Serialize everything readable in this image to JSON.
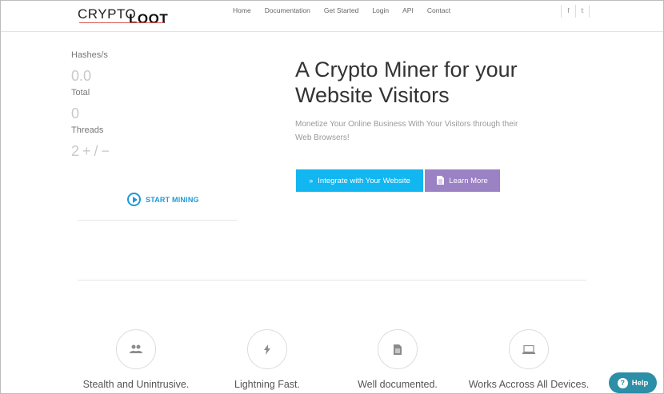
{
  "header": {
    "logo_left": "CRYPTO",
    "logo_right": "LOOT",
    "nav": [
      "Home",
      "Documentation",
      "Get Started",
      "Login",
      "API",
      "Contact"
    ],
    "social": [
      {
        "icon": "facebook-icon",
        "glyph": "f"
      },
      {
        "icon": "twitter-icon",
        "glyph": "𝕥"
      }
    ]
  },
  "stats": {
    "hashes_label": "Hashes/s",
    "hashes_value": "0.0",
    "total_label": "Total",
    "total_value": "0",
    "threads_label": "Threads",
    "threads_value": "2",
    "plus": "+",
    "slash": "/",
    "minus": "−",
    "start_label": "START MINING"
  },
  "hero": {
    "title_line1": "A Crypto Miner for your",
    "title_line2": "Website Visitors",
    "subtitle": "Monetize Your Online Business With Your Visitors through their Web Browsers!",
    "integrate_label": "Integrate with Your Website",
    "learn_label": "Learn More",
    "integrate_color": "#12b6f0",
    "learn_color": "#9a82c4"
  },
  "features": [
    {
      "icon": "users-icon",
      "glyph": "👥",
      "title": "Stealth and Unintrusive."
    },
    {
      "icon": "lightning-icon",
      "glyph": "ϟ",
      "title": "Lightning Fast."
    },
    {
      "icon": "document-icon",
      "glyph": "▤",
      "title": "Well documented."
    },
    {
      "icon": "laptop-icon",
      "glyph": "▭",
      "title": "Works Accross All Devices."
    }
  ],
  "help": {
    "label": "Help",
    "icon": "question-icon"
  }
}
